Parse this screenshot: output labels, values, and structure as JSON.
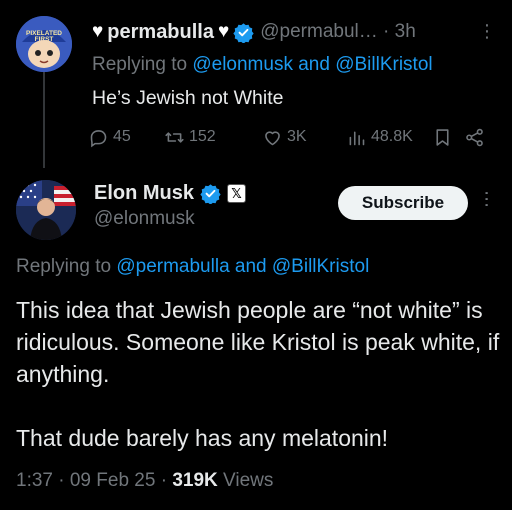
{
  "reply_tweet": {
    "display_name": "permabulla",
    "handle_time": "@permabul… · 3h",
    "replying_prefix": "Replying to",
    "replying_mentions": "@elonmusk and @BillKristol",
    "text": "He’s Jewish not White",
    "stats": {
      "replies": "45",
      "retweets": "152",
      "likes": "3K",
      "views": "48.8K"
    },
    "avatar_cap_text": "PIXELATED FIRST"
  },
  "main_tweet": {
    "display_name": "Elon Musk",
    "handle": "@elonmusk",
    "subscribe_label": "Subscribe",
    "replying_prefix": "Replying to",
    "replying_mentions": "@permabulla and @BillKristol",
    "text_lines": [
      "This idea that Jewish people are “not white” is ridiculous. Someone like Kristol is peak white, if anything.",
      "That dude barely has any melatonin!"
    ],
    "timestamp": "1:37 · 09 Feb 25 · ",
    "views_count": "319K",
    "views_label": " Views"
  },
  "colors": {
    "background": "#000000",
    "text_primary": "#e7e9ea",
    "text_secondary": "#71767b",
    "accent": "#1d9bf0",
    "verified": "#1d9bf0"
  },
  "icons": [
    "reply-icon",
    "retweet-icon",
    "like-icon",
    "views-icon",
    "bookmark-icon",
    "share-icon",
    "verified-badge-icon",
    "x-affiliate-icon",
    "more-icon"
  ]
}
